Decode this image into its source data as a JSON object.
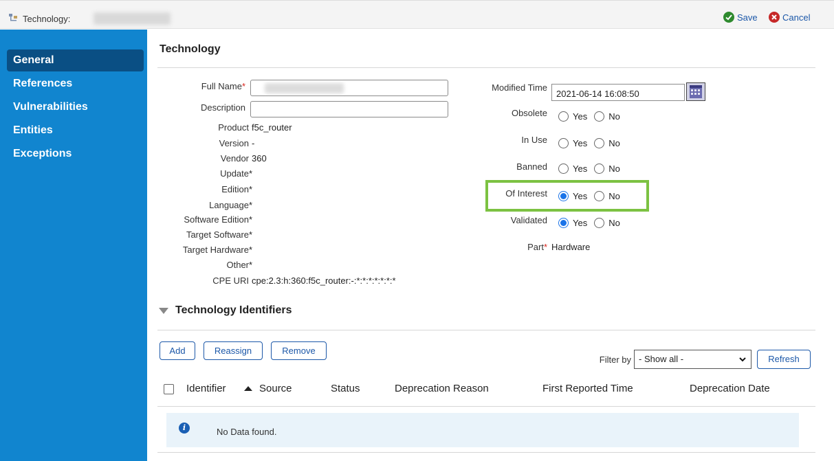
{
  "titlebar": {
    "label": "Technology:",
    "save_label": "Save",
    "cancel_label": "Cancel"
  },
  "sidebar": {
    "items": [
      {
        "label": "General",
        "active": true
      },
      {
        "label": "References"
      },
      {
        "label": "Vulnerabilities"
      },
      {
        "label": "Entities"
      },
      {
        "label": "Exceptions"
      }
    ]
  },
  "technology": {
    "title": "Technology",
    "full_name_label": "Full Name",
    "required_mark": "*",
    "description_label": "Description",
    "description_value": "",
    "product_label": "Product",
    "product_value": "f5c_router",
    "version_label": "Version",
    "version_value": "-",
    "vendor_label": "Vendor",
    "vendor_value": "360",
    "update_label": "Update",
    "update_value": "*",
    "edition_label": "Edition",
    "edition_value": "*",
    "language_label": "Language",
    "language_value": "*",
    "software_edition_label": "Software Edition",
    "software_edition_value": "*",
    "target_software_label": "Target Software",
    "target_software_value": "*",
    "target_hardware_label": "Target Hardware",
    "target_hardware_value": "*",
    "other_label": "Other",
    "other_value": "*",
    "cpe_uri_label": "CPE URI",
    "cpe_uri_value": "cpe:2.3:h:360:f5c_router:-:*:*:*:*:*:*:*",
    "modified_time_label": "Modified Time",
    "modified_time_value": "2021-06-14 16:08:50",
    "yes_label": "Yes",
    "no_label": "No",
    "obsolete_label": "Obsolete",
    "obsolete_selected": "none",
    "in_use_label": "In Use",
    "in_use_selected": "none",
    "banned_label": "Banned",
    "banned_selected": "none",
    "of_interest_label": "Of Interest",
    "of_interest_selected": "yes",
    "validated_label": "Validated",
    "validated_selected": "yes",
    "part_label": "Part",
    "part_value": "Hardware"
  },
  "identifiers": {
    "title": "Technology Identifiers",
    "add_label": "Add",
    "reassign_label": "Reassign",
    "remove_label": "Remove",
    "filter_label": "Filter by",
    "filter_value": "- Show all -",
    "refresh_label": "Refresh",
    "columns": [
      "Identifier",
      "Source",
      "Status",
      "Deprecation Reason",
      "First Reported Time",
      "Deprecation Date"
    ],
    "sort_column": "Identifier",
    "empty_text": "No Data found."
  },
  "colors": {
    "sidebar_bg": "#1185cf",
    "sidebar_active": "#0a4f84",
    "accent": "#1b57a8",
    "highlight_border": "#7cc242",
    "radio_checked": "#1a73e8"
  }
}
